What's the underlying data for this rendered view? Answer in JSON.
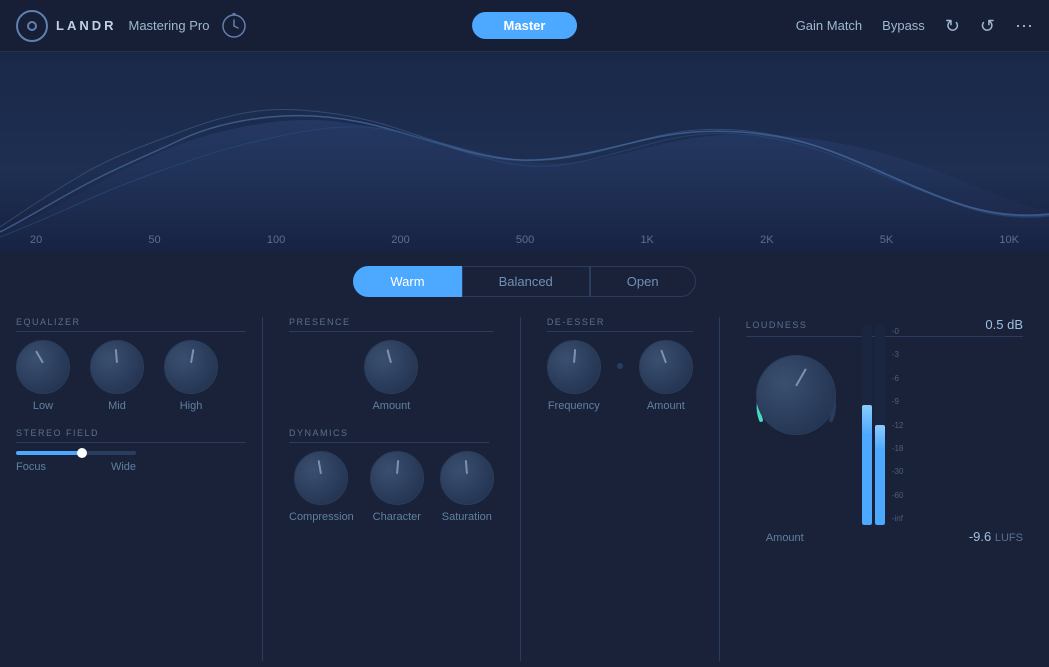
{
  "header": {
    "brand": "LANDR",
    "app": "Mastering Pro",
    "master_label": "Master",
    "gain_match": "Gain Match",
    "bypass": "Bypass"
  },
  "eq_modes": {
    "options": [
      "Warm",
      "Balanced",
      "Open"
    ],
    "active": "Warm"
  },
  "freq_labels": [
    "20",
    "50",
    "100",
    "200",
    "500",
    "1K",
    "2K",
    "5K",
    "10K"
  ],
  "equalizer": {
    "label": "EQUALIZER",
    "knobs": [
      {
        "id": "low",
        "label": "Low",
        "rotation": -10
      },
      {
        "id": "mid",
        "label": "Mid",
        "rotation": -5
      },
      {
        "id": "high",
        "label": "High",
        "rotation": 10
      }
    ]
  },
  "presence": {
    "label": "PRESENCE",
    "knob": {
      "id": "amount",
      "label": "Amount",
      "rotation": -15
    }
  },
  "deesser": {
    "label": "DE-ESSER",
    "knobs": [
      {
        "id": "frequency",
        "label": "Frequency",
        "rotation": 5
      },
      {
        "id": "amount",
        "label": "Amount",
        "rotation": -20
      }
    ]
  },
  "loudness": {
    "label": "LOUDNESS",
    "db_value": "0.5",
    "db_unit": "dB",
    "amount_label": "Amount",
    "lufs_value": "-9.6",
    "lufs_unit": "LUFS",
    "meter_labels": [
      "-0",
      "-3",
      "-6",
      "-9",
      "-12",
      "-18",
      "-30",
      "-60",
      "-inf"
    ]
  },
  "stereo_field": {
    "label": "STEREO FIELD",
    "focus_label": "Focus",
    "wide_label": "Wide",
    "slider_pct": 55
  },
  "dynamics": {
    "label": "DYNAMICS",
    "knobs": [
      {
        "id": "compression",
        "label": "Compression",
        "rotation": -10
      },
      {
        "id": "character",
        "label": "Character",
        "rotation": 5
      },
      {
        "id": "saturation",
        "label": "Saturation",
        "rotation": -5
      }
    ]
  }
}
